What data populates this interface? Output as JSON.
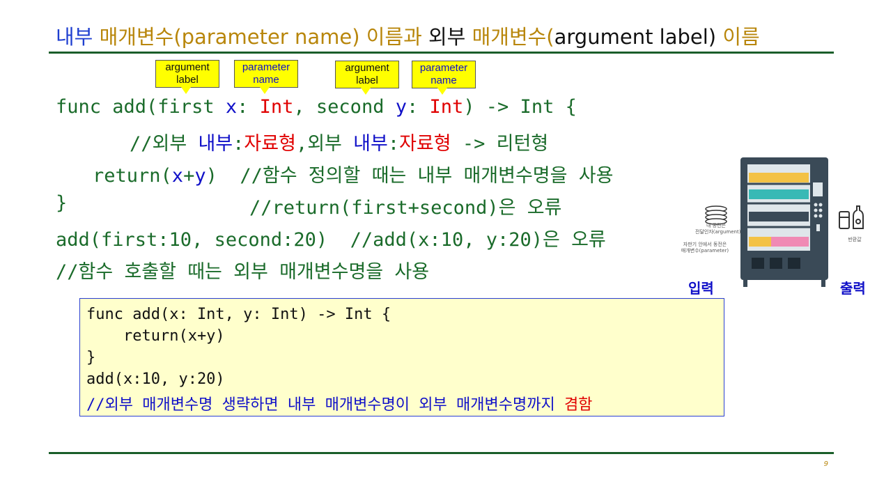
{
  "title": {
    "p1": "내부 ",
    "p2": "매개변수(parameter name)",
    "p3": " 이름과",
    "p4": " 외부 ",
    "p5": "매개변수(",
    "p6": "argument label)",
    "p7": " 이름"
  },
  "callouts": [
    {
      "l1": "argument",
      "l2": "label"
    },
    {
      "l1": "parameter",
      "l2": "name"
    },
    {
      "l1": "argument",
      "l2": "label"
    },
    {
      "l1": "parameter",
      "l2": "name"
    }
  ],
  "code": {
    "l1": {
      "a": "func add(first ",
      "b": "x",
      "c": ": ",
      "d": "Int",
      "e": ", second ",
      "f": "y",
      "g": ": ",
      "h": "Int",
      "i": ") -> Int {"
    },
    "l2": {
      "a": "//외부 ",
      "b": "내부",
      "c": ":",
      "d": "자료형",
      "e": ",외부 ",
      "f": "내부",
      "g": ":",
      "h": "자료형",
      "i": " -> 리턴형"
    },
    "l3": {
      "a": "return(",
      "b": "x",
      "c": "+",
      "d": "y",
      "e": ")  //함수 정의할 때는 내부 매개변수명을 사용"
    },
    "l4": {
      "a": "}",
      "b": "//return(first+second)은 오류"
    },
    "l5": {
      "a": "add(first:10, second:20)  //add(x:10, y:20)은 오류"
    },
    "l6": {
      "a": "//함수 호출할 때는 외부 매개변수명을 사용"
    }
  },
  "box": {
    "l1": "func add(x: Int, y: Int) -> Int {",
    "l2": "    return(x+y)",
    "l3": "}",
    "l4": "add(x:10, y:20)",
    "l5a": "//외부 매개변수명 생략하면 내부 매개변수명이 외부 매개변수명까지 ",
    "l5b": "겸함"
  },
  "vending": {
    "coin_t1": "내 동전은",
    "coin_t2": "전달인자(argument)",
    "coin_t3": "자판기 안에서 동전은",
    "coin_t4": "매개변수(parameter)",
    "return_t": "반환값",
    "input": "입력",
    "output": "출력"
  },
  "page_number": "9"
}
